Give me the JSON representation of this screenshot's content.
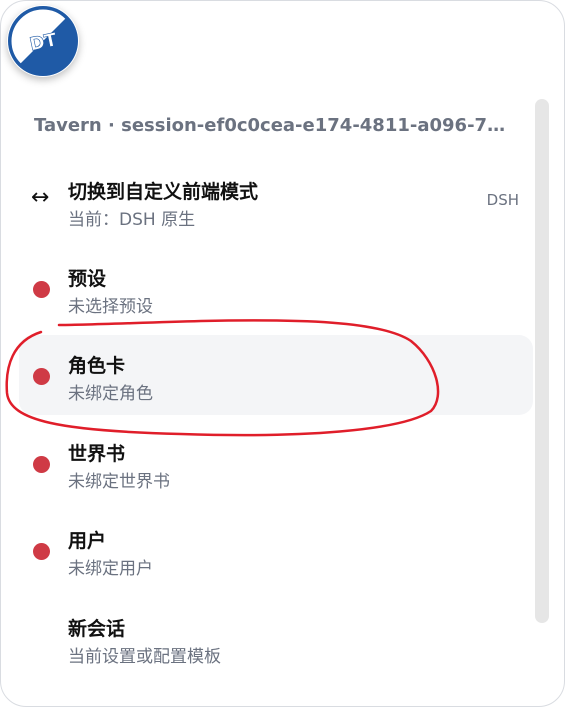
{
  "logo": {
    "text": "DT",
    "colors": {
      "primary": "#1f5aa6",
      "light": "#ffffff"
    }
  },
  "session": {
    "title": "Tavern · session-ef0c0cea-e174-4811-a096-743..."
  },
  "menu": {
    "items": [
      {
        "icon": "↔",
        "title": "切换到自定义前端模式",
        "subtitle": "当前：DSH 原生",
        "badge": "DSH"
      },
      {
        "title": "预设",
        "subtitle": "未选择预设"
      },
      {
        "title": "角色卡",
        "subtitle": "未绑定角色"
      },
      {
        "title": "世界书",
        "subtitle": "未绑定世界书"
      },
      {
        "title": "用户",
        "subtitle": "未绑定用户"
      },
      {
        "title": "新会话",
        "subtitle": "当前设置或配置模板"
      }
    ]
  },
  "colors": {
    "status_dot": "#cf3a45",
    "annotation": "#e01e2a",
    "active_bg": "#f4f5f7"
  }
}
